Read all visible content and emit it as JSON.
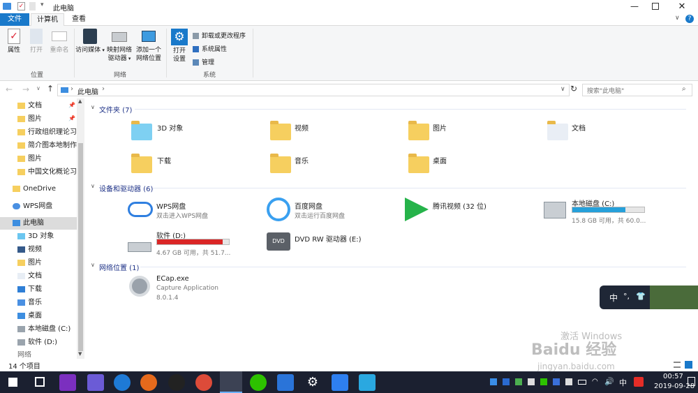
{
  "window": {
    "title": "此电脑"
  },
  "ribbon_tabs": [
    "文件",
    "计算机",
    "查看"
  ],
  "ribbon": {
    "location": {
      "properties": "属性",
      "open": "打开",
      "rename": "重命名",
      "group": "位置"
    },
    "network": {
      "media": "访问媒体",
      "map_drive_1": "映射网络",
      "map_drive_2": "驱动器",
      "add_loc_1": "添加一个",
      "add_loc_2": "网络位置",
      "group": "网络"
    },
    "system": {
      "open_settings_1": "打开",
      "open_settings_2": "设置",
      "uninstall": "卸载或更改程序",
      "sys_props": "系统属性",
      "manage": "管理",
      "group": "系统"
    }
  },
  "address": {
    "path": "此电脑",
    "search_placeholder": "搜索\"此电脑\""
  },
  "sidebar": {
    "quick": [
      "文档",
      "图片",
      "行政组织理论习",
      "简介图本地制作",
      "图片",
      "中国文化概论习"
    ],
    "onedrive": "OneDrive",
    "wps": "WPS网盘",
    "thispc": "此电脑",
    "pc_items": [
      "3D 对象",
      "视频",
      "图片",
      "文档",
      "下载",
      "音乐",
      "桌面",
      "本地磁盘 (C:)",
      "软件 (D:)"
    ],
    "network": "网络"
  },
  "sections": {
    "folders": "文件夹 (7)",
    "devices": "设备和驱动器 (6)",
    "netloc": "网络位置 (1)"
  },
  "folders": [
    "3D 对象",
    "视频",
    "图片",
    "文档",
    "下载",
    "音乐",
    "桌面"
  ],
  "devices": [
    {
      "name": "WPS网盘",
      "sub": "双击进入WPS网盘"
    },
    {
      "name": "百度网盘",
      "sub": "双击运行百度网盘"
    },
    {
      "name": "腾讯视频 (32 位)",
      "sub": ""
    },
    {
      "name": "本地磁盘 (C:)",
      "sub": "15.8 GB 可用，共 60.0..."
    },
    {
      "name": "软件 (D:)",
      "sub": "4.67 GB 可用，共 51.7..."
    },
    {
      "name": "DVD RW 驱动器 (E:)",
      "sub": ""
    }
  ],
  "drive_usage": {
    "c_used_fraction": 0.74,
    "d_used_fraction": 0.91
  },
  "netloc": {
    "name": "ECap.exe",
    "sub1": "Capture Application",
    "sub2": "8.0.1.4"
  },
  "status": {
    "count": "14 个项目"
  },
  "ime": {
    "lang": "中",
    "punct": "°,"
  },
  "watermark": {
    "line1": "激活 Windows",
    "line2": "Baidu 经验",
    "line3": "jingyan.baidu.com"
  },
  "taskbar": {
    "time": "00:57",
    "date": "2019-09-28",
    "lang": "中"
  },
  "colors": {
    "accent": "#1979ca",
    "c_bar": "#26a0da",
    "d_bar": "#da2626",
    "taskbar": "#1b2030"
  }
}
